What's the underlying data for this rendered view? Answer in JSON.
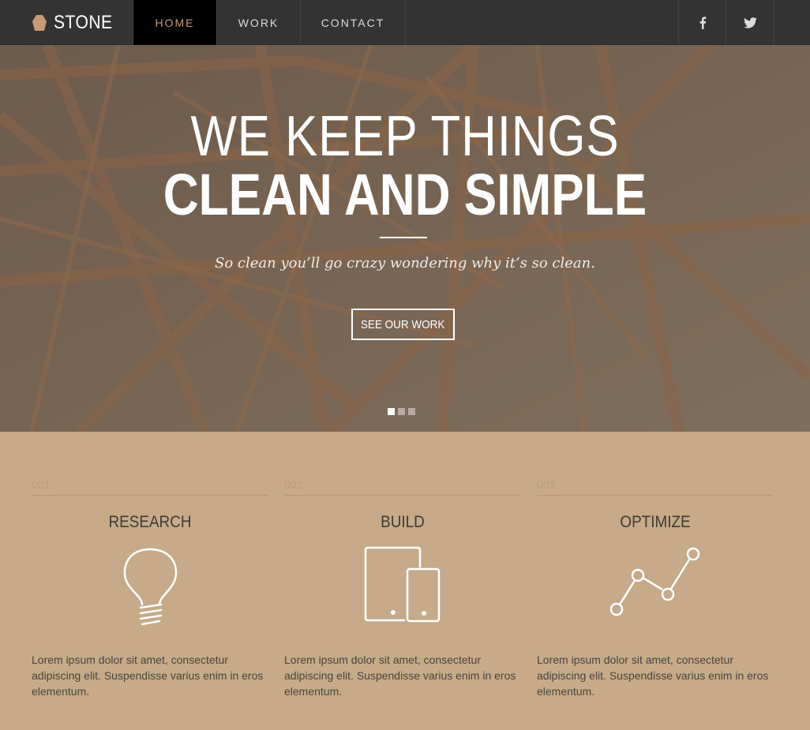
{
  "brand": {
    "name": "STONE",
    "logo_icon": "hexagon-icon",
    "logo_color": "#c59b74"
  },
  "nav": {
    "items": [
      {
        "label": "HOME",
        "active": true
      },
      {
        "label": "WORK",
        "active": false
      },
      {
        "label": "CONTACT",
        "active": false
      }
    ],
    "social": [
      {
        "icon": "facebook-icon",
        "glyph": "f"
      },
      {
        "icon": "twitter-icon"
      }
    ]
  },
  "hero": {
    "line1": "WE KEEP THINGS",
    "line2": "CLEAN AND SIMPLE",
    "tagline": "So clean you’ll go crazy wondering why it’s so clean.",
    "button_label": "SEE OUR WORK",
    "slides": 3,
    "active_slide": 1
  },
  "features": [
    {
      "number": "001",
      "title": "RESEARCH",
      "icon": "lightbulb-icon",
      "text": "Lorem ipsum dolor sit amet, consectetur adipiscing elit. Suspendisse varius enim in eros elementum."
    },
    {
      "number": "002",
      "title": "BUILD",
      "icon": "devices-icon",
      "text": "Lorem ipsum dolor sit amet, consectetur adipiscing elit. Suspendisse varius enim in eros elementum."
    },
    {
      "number": "003",
      "title": "OPTIMIZE",
      "icon": "line-graph-icon",
      "text": "Lorem ipsum dolor sit amet, consectetur adipiscing elit. Suspendisse varius enim in eros elementum."
    }
  ],
  "colors": {
    "nav_bg": "#333333",
    "accent": "#c59b74",
    "features_bg": "#c6aa89",
    "hero_overlay": "#7a6553"
  }
}
